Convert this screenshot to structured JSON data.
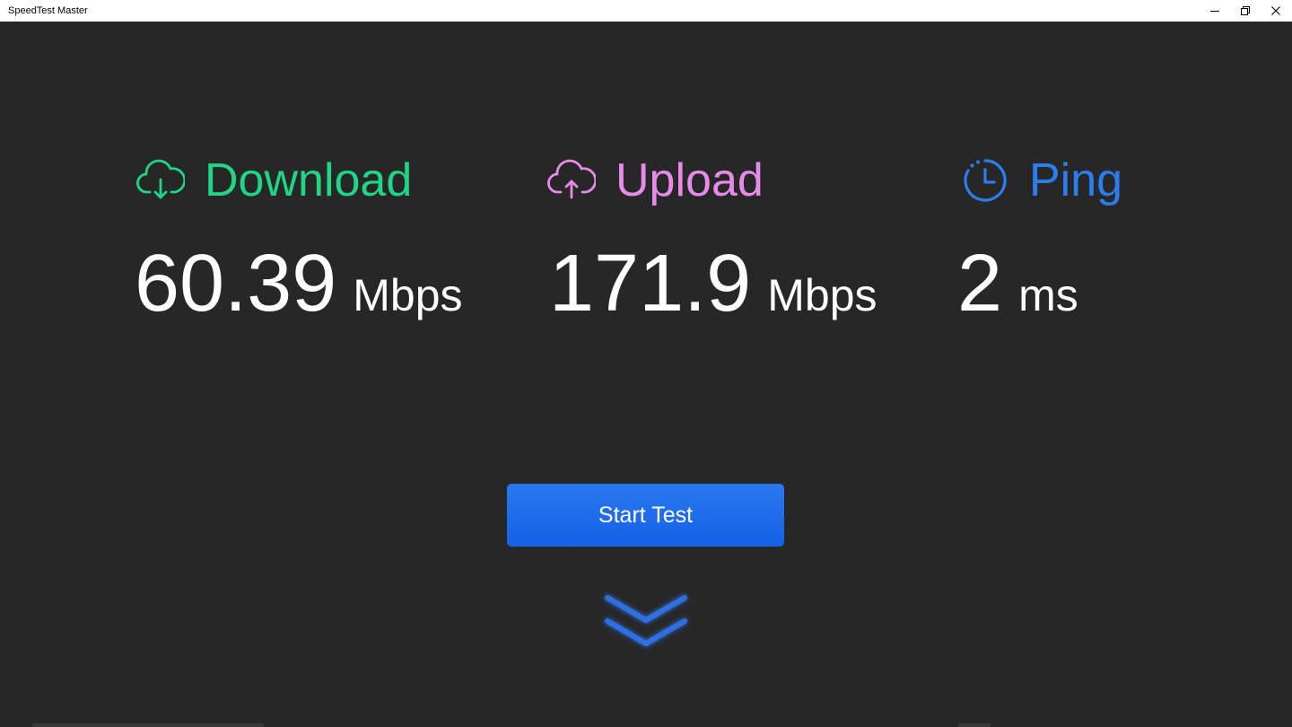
{
  "window": {
    "title": "SpeedTest Master"
  },
  "metrics": {
    "download": {
      "label": "Download",
      "value": "60.39",
      "unit": "Mbps",
      "color": "#1fd686",
      "icon": "cloud-download-icon"
    },
    "upload": {
      "label": "Upload",
      "value": "171.9",
      "unit": "Mbps",
      "color": "#e88ae8",
      "icon": "cloud-upload-icon"
    },
    "ping": {
      "label": "Ping",
      "value": "2",
      "unit": "ms",
      "color": "#2a7ef0",
      "icon": "clock-icon"
    }
  },
  "actions": {
    "start_label": "Start Test",
    "expand_icon": "double-chevron-down-icon"
  },
  "colors": {
    "background": "#272727",
    "button": "#1d68eb"
  }
}
